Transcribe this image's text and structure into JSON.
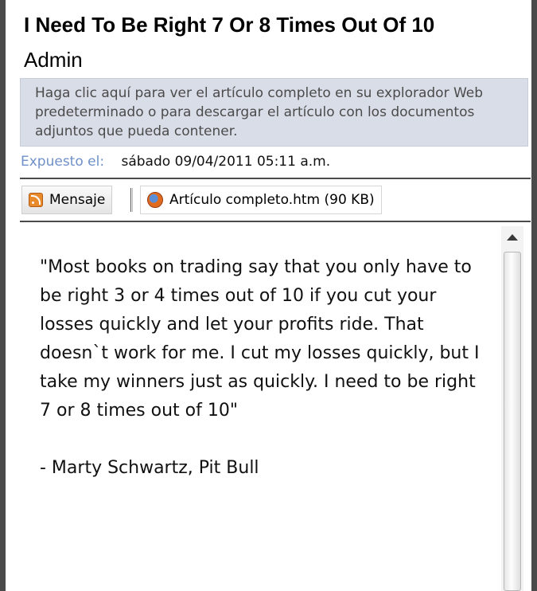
{
  "header": {
    "title": "I Need To Be Right 7 Or 8 Times Out Of 10",
    "author": "Admin"
  },
  "infobar": {
    "text": "Haga clic aquí para ver el artículo completo en su explorador Web predeterminado o para descargar el artículo con los documentos adjuntos que pueda contener."
  },
  "posted": {
    "label": "Expuesto el:",
    "value": "sábado 09/04/2011 05:11 a.m."
  },
  "tabs": {
    "message_label": "Mensaje",
    "attachment_label": "Artículo completo.htm (90 KB)"
  },
  "icons": {
    "message": "rss-feed-icon",
    "attachment": "firefox-icon",
    "scroll_up": "scroll-up-arrow-icon"
  },
  "article": {
    "quote": "\"Most books on trading say that you only have to be right 3 or 4 times out of 10 if you cut your losses quickly and let your profits ride. That doesn`t work for me. I cut my losses quickly, but I take my winners just as quickly. I need to be right 7 or 8 times out of 10\"",
    "attribution": "- Marty Schwartz, Pit Bull"
  },
  "colors": {
    "infobar_bg": "#d9dde8",
    "posted_label": "#6f90c8",
    "frame": "#4a4a4a"
  }
}
